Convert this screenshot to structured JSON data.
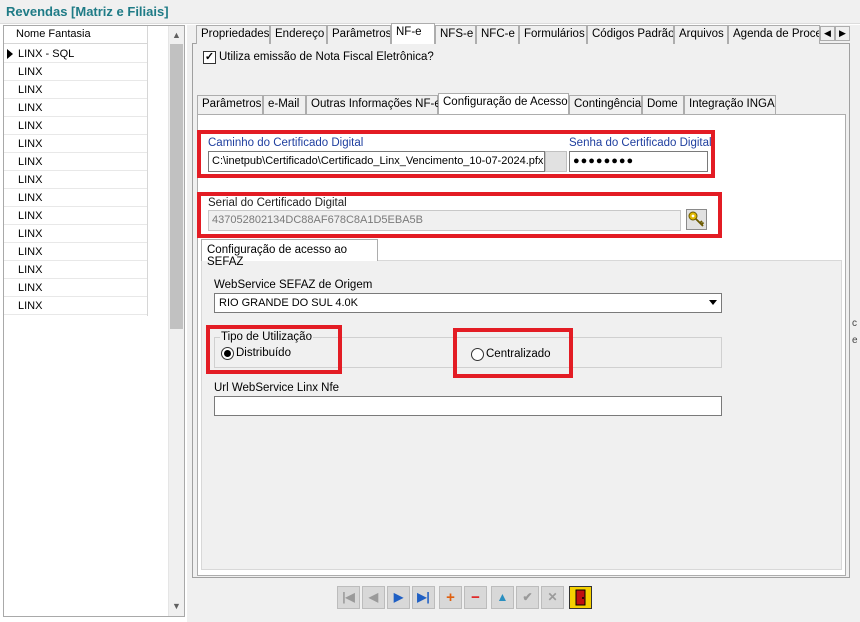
{
  "window": {
    "title": "Revendas [Matriz e Filiais]"
  },
  "grid": {
    "header": "Nome Fantasia",
    "rows": [
      "LINX - SQL",
      "LINX",
      "LINX",
      "LINX",
      "LINX",
      "LINX",
      "LINX",
      "LINX",
      "LINX",
      "LINX",
      "LINX",
      "LINX",
      "LINX",
      "LINX",
      "LINX"
    ]
  },
  "top_tabs": [
    "Propriedades",
    "Endereço",
    "Parâmetros",
    "NF-e",
    "NFS-e",
    "NFC-e",
    "Formulários",
    "Códigos Padrão",
    "Arquivos",
    "Agenda de Proces"
  ],
  "top_tabs_active": "NF-e",
  "checkbox_nfe": {
    "label": "Utiliza emissão de Nota Fiscal Eletrônica?",
    "checked": true
  },
  "sub_tabs": [
    "Parâmetros",
    "e-Mail",
    "Outras Informações NF-e",
    "Configuração de Acesso",
    "Contingência",
    "Dome",
    "Integração INGA"
  ],
  "sub_tabs_active": "Configuração de Acesso",
  "certificado": {
    "path_label": "Caminho do Certificado Digital",
    "path_value": "C:\\inetpub\\Certificado\\Certificado_Linx_Vencimento_10-07-2024.pfx",
    "password_label": "Senha do Certificado Digital",
    "password_value": "●●●●●●●●",
    "serial_label": "Serial do Certificado Digital",
    "serial_value": "437052802134DC88AF678C8A1D5EBA5B"
  },
  "sefaz": {
    "tab_label": "Configuração de acesso ao SEFAZ",
    "webservice_label": "WebService SEFAZ de Origem",
    "webservice_value": "RIO GRANDE DO SUL 4.0K",
    "tipo_label": "Tipo de Utilização",
    "option_distribuido": "Distribuído",
    "option_centralizado": "Centralizado",
    "selected": "Distribuído",
    "url_label": "Url WebService Linx Nfe",
    "url_value": ""
  },
  "edge_fragments": [
    "c",
    "e"
  ],
  "colors": {
    "highlight": "#e31c24",
    "title": "#1f7b86",
    "blue_label": "#1f3f9f"
  }
}
